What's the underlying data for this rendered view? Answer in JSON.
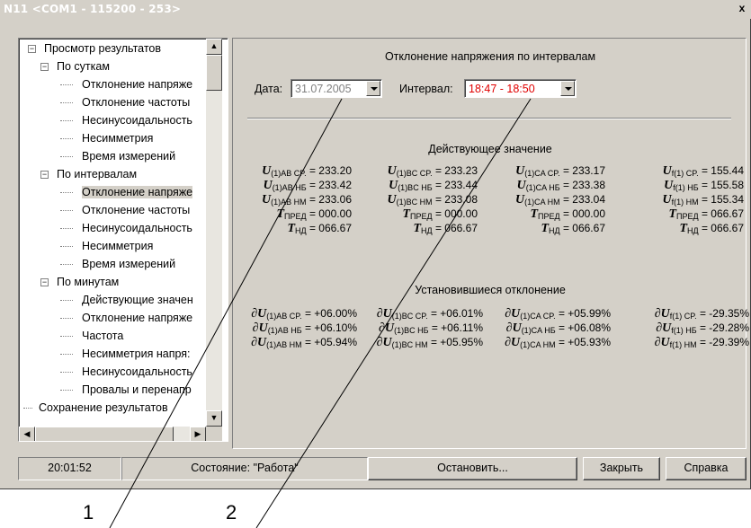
{
  "window": {
    "title": "N11 <COM1 - 115200 - 253>",
    "close_label": "x"
  },
  "tree": {
    "items": [
      {
        "label": "Просмотр результатов",
        "level": 0,
        "expander": "−"
      },
      {
        "label": "По суткам",
        "level": 1,
        "expander": "−"
      },
      {
        "label": "Отклонение напряже",
        "level": 2
      },
      {
        "label": "Отклонение частоты",
        "level": 2
      },
      {
        "label": "Несинусоидальность",
        "level": 2
      },
      {
        "label": "Несимметрия",
        "level": 2
      },
      {
        "label": "Время измерений",
        "level": 2
      },
      {
        "label": "По интервалам",
        "level": 1,
        "expander": "−"
      },
      {
        "label": "Отклонение напряже",
        "level": 2,
        "selected": true
      },
      {
        "label": "Отклонение частоты",
        "level": 2
      },
      {
        "label": "Несинусоидальность",
        "level": 2
      },
      {
        "label": "Несимметрия",
        "level": 2
      },
      {
        "label": "Время измерений",
        "level": 2
      },
      {
        "label": "По минутам",
        "level": 1,
        "expander": "−"
      },
      {
        "label": "Действующие значен",
        "level": 2
      },
      {
        "label": "Отклонение напряже",
        "level": 2
      },
      {
        "label": "Частота",
        "level": 2
      },
      {
        "label": "Несимметрия напря:",
        "level": 2
      },
      {
        "label": "Несинусоидальность",
        "level": 2
      },
      {
        "label": "Провалы и перенапр",
        "level": 2
      },
      {
        "label": "Сохранение результатов",
        "level": 0
      }
    ]
  },
  "main": {
    "title": "Отклонение напряжения по интервалам",
    "date_label": "Дата:",
    "date_value": "31.07.2005",
    "interval_label": "Интервал:",
    "interval_value": "18:47 - 18:50",
    "interval_color": "#e00000",
    "date_color": "#808080"
  },
  "effective": {
    "title": "Действующее значение",
    "rows": [
      [
        {
          "sym": "U",
          "sub": "(1)AB CP.",
          "val": "= 233.20"
        },
        {
          "sym": "U",
          "sub": "(1)BC CP.",
          "val": "= 233.23"
        },
        {
          "sym": "U",
          "sub": "(1)CA CP.",
          "val": "= 233.17"
        },
        {
          "sym": "U",
          "sub": "f(1) CP.",
          "val": "= 155.44"
        }
      ],
      [
        {
          "sym": "U",
          "sub": "(1)AB НБ",
          "val": "= 233.42"
        },
        {
          "sym": "U",
          "sub": "(1)BC НБ",
          "val": "= 233.44"
        },
        {
          "sym": "U",
          "sub": "(1)CA НБ",
          "val": "= 233.38"
        },
        {
          "sym": "U",
          "sub": "f(1) НБ",
          "val": "= 155.58"
        }
      ],
      [
        {
          "sym": "U",
          "sub": "(1)AB НМ",
          "val": "= 233.06"
        },
        {
          "sym": "U",
          "sub": "(1)BC НМ",
          "val": "= 233.08"
        },
        {
          "sym": "U",
          "sub": "(1)CA НМ",
          "val": "= 233.04"
        },
        {
          "sym": "U",
          "sub": "f(1) НМ",
          "val": "= 155.34"
        }
      ],
      [
        {
          "sym": "T",
          "sub": "ПРЕД",
          "val": "= 000.00"
        },
        {
          "sym": "T",
          "sub": "ПРЕД",
          "val": "= 000.00"
        },
        {
          "sym": "T",
          "sub": "ПРЕД",
          "val": "= 000.00"
        },
        {
          "sym": "T",
          "sub": "ПРЕД",
          "val": "= 066.67"
        }
      ],
      [
        {
          "sym": "T",
          "sub": "НД",
          "val": "= 066.67"
        },
        {
          "sym": "T",
          "sub": "НД",
          "val": "= 066.67"
        },
        {
          "sym": "T",
          "sub": "НД",
          "val": "= 066.67"
        },
        {
          "sym": "T",
          "sub": "НД",
          "val": "= 066.67"
        }
      ]
    ]
  },
  "steady": {
    "title": "Установившиеся отклонение",
    "rows": [
      [
        {
          "sym": "∂U",
          "sub": "(1)AB CP.",
          "val": "= +06.00%"
        },
        {
          "sym": "∂U",
          "sub": "(1)BC CP.",
          "val": "= +06.01%"
        },
        {
          "sym": "∂U",
          "sub": "(1)CA CP.",
          "val": "= +05.99%"
        },
        {
          "sym": "∂U",
          "sub": "f(1) CP.",
          "val": "= -29.35%"
        }
      ],
      [
        {
          "sym": "∂U",
          "sub": "(1)AB НБ",
          "val": "= +06.10%"
        },
        {
          "sym": "∂U",
          "sub": "(1)BC НБ",
          "val": "= +06.11%"
        },
        {
          "sym": "∂U",
          "sub": "(1)CA НБ",
          "val": "= +06.08%"
        },
        {
          "sym": "∂U",
          "sub": "f(1) НБ",
          "val": "= -29.28%"
        }
      ],
      [
        {
          "sym": "∂U",
          "sub": "(1)AB НМ",
          "val": "= +05.94%"
        },
        {
          "sym": "∂U",
          "sub": "(1)BC НМ",
          "val": "= +05.95%"
        },
        {
          "sym": "∂U",
          "sub": "(1)CA НМ",
          "val": "= +05.93%"
        },
        {
          "sym": "∂U",
          "sub": "f(1) НМ",
          "val": "= -29.39%"
        }
      ]
    ]
  },
  "status": {
    "time": "20:01:52",
    "state": "Состояние: \"Работа\"",
    "stop_label": "Остановить...",
    "close_label": "Закрыть",
    "help_label": "Справка"
  },
  "callouts": {
    "one": "1",
    "two": "2"
  }
}
